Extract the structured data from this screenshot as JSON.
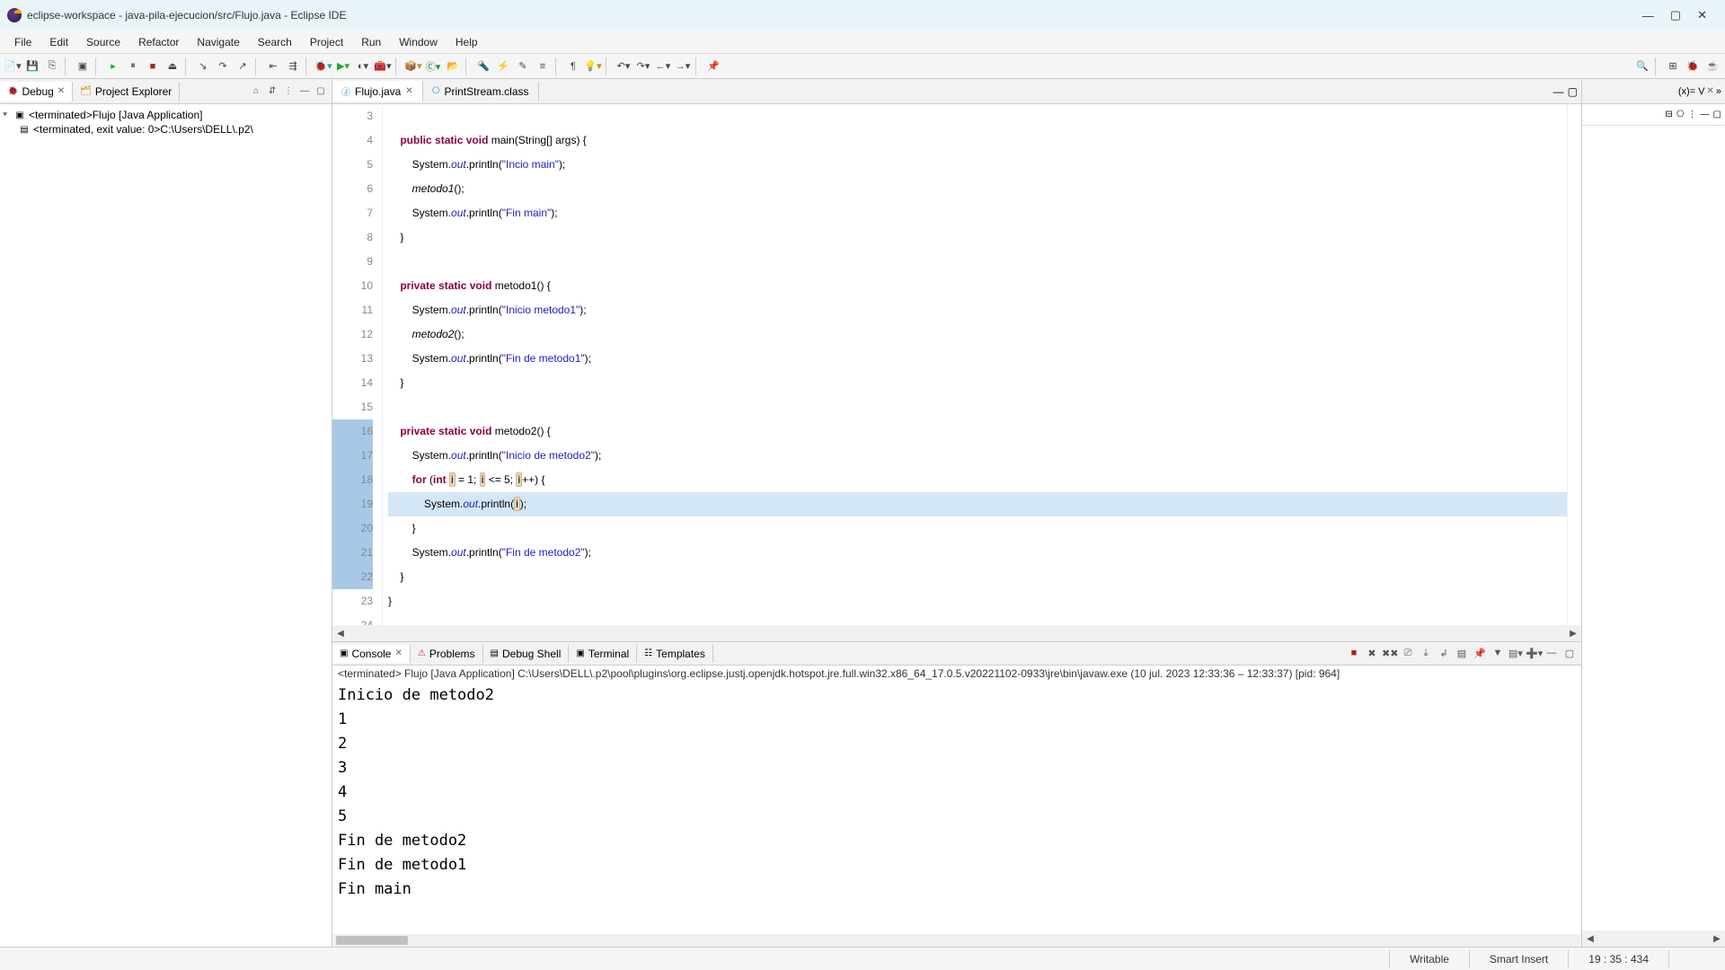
{
  "title": "eclipse-workspace - java-pila-ejecucion/src/Flujo.java - Eclipse IDE",
  "menu": [
    "File",
    "Edit",
    "Source",
    "Refactor",
    "Navigate",
    "Search",
    "Project",
    "Run",
    "Window",
    "Help"
  ],
  "left": {
    "tabs": [
      "Debug",
      "Project Explorer"
    ],
    "tree_root": "<terminated>Flujo [Java Application]",
    "tree_child": "<terminated, exit value: 0>C:\\Users\\DELL\\.p2\\"
  },
  "editor": {
    "tabs": [
      "Flujo.java",
      "PrintStream.class"
    ],
    "lines": [
      {
        "n": 3,
        "raw": ""
      },
      {
        "n": 4,
        "html": "    <span class='kw'>public</span> <span class='kw'>static</span> <span class='kw'>void</span> main(String[] args) {"
      },
      {
        "n": 5,
        "html": "        System.<span class='field'>out</span>.println(<span class='str'>\"Incio main\"</span>);"
      },
      {
        "n": 6,
        "html": "        <span style='font-style:italic'>metodo1</span>();"
      },
      {
        "n": 7,
        "html": "        System.<span class='field'>out</span>.println(<span class='str'>\"Fin main\"</span>);"
      },
      {
        "n": 8,
        "raw": "    }"
      },
      {
        "n": 9,
        "raw": ""
      },
      {
        "n": 10,
        "html": "    <span class='kw'>private</span> <span class='kw'>static</span> <span class='kw'>void</span> metodo1() {"
      },
      {
        "n": 11,
        "html": "        System.<span class='field'>out</span>.println(<span class='str'>\"Inicio metodo1\"</span>);"
      },
      {
        "n": 12,
        "html": "        <span style='font-style:italic'>metodo2</span>();"
      },
      {
        "n": 13,
        "html": "        System.<span class='field'>out</span>.println(<span class='str'>\"Fin de metodo1\"</span>);"
      },
      {
        "n": 14,
        "raw": "    }"
      },
      {
        "n": 15,
        "raw": ""
      },
      {
        "n": 16,
        "marked": true,
        "html": "    <span class='kw'>private</span> <span class='kw'>static</span> <span class='kw'>void</span> metodo2() {"
      },
      {
        "n": 17,
        "marked": true,
        "html": "        System.<span class='field'>out</span>.println(<span class='str'>\"Inicio de metodo2\"</span>);"
      },
      {
        "n": 18,
        "marked": true,
        "html": "        <span class='kw'>for</span> (<span class='kw'>int</span> <span class='var-hl'>i</span> = 1; <span class='var-hl'>i</span> &lt;= 5; <span class='var-hl'>i</span>++) {"
      },
      {
        "n": 19,
        "marked": true,
        "hl": true,
        "html": "            System.<span class='field'>out</span>.println(<span class='var-hl'>i</span>);"
      },
      {
        "n": 20,
        "marked": true,
        "raw": "        }"
      },
      {
        "n": 21,
        "marked": true,
        "html": "        System.<span class='field'>out</span>.println(<span class='str'>\"Fin de metodo2\"</span>);"
      },
      {
        "n": 22,
        "marked": true,
        "raw": "    }"
      },
      {
        "n": 23,
        "raw": "}"
      },
      {
        "n": 24,
        "raw": ""
      }
    ]
  },
  "bottom": {
    "tabs": [
      "Console",
      "Problems",
      "Debug Shell",
      "Terminal",
      "Templates"
    ],
    "header": "<terminated> Flujo [Java Application] C:\\Users\\DELL\\.p2\\pool\\plugins\\org.eclipse.justj.openjdk.hotspot.jre.full.win32.x86_64_17.0.5.v20221102-0933\\jre\\bin\\javaw.exe  (10 jul. 2023 12:33:36 – 12:33:37) [pid: 964]",
    "output": "Inicio de metodo2\n1\n2\n3\n4\n5\nFin de metodo2\nFin de metodo1\nFin main"
  },
  "status": {
    "writable": "Writable",
    "insert": "Smart Insert",
    "pos": "19 : 35 : 434"
  },
  "right_tab": "(x)= V"
}
